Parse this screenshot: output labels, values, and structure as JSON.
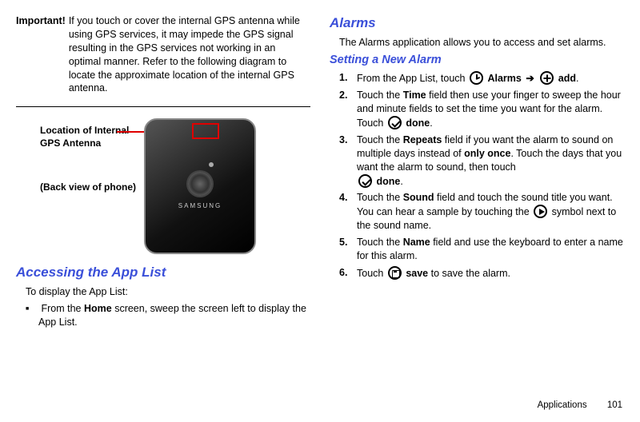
{
  "left": {
    "important_label": "Important!",
    "important_text": "If you touch or cover the internal GPS antenna while using GPS services, it may impede the GPS signal resulting in the GPS services not working in an optimal manner. Refer to the following diagram to locate the approximate location of the internal GPS antenna.",
    "diagram": {
      "label_top": "Location of Internal GPS Antenna",
      "label_bottom": "(Back view of phone)",
      "brand": "SAMSUNG"
    },
    "section_heading": "Accessing the App List",
    "intro": "To display the App List:",
    "bullet_pre": "From the ",
    "bullet_bold": "Home",
    "bullet_post": " screen, sweep the screen left to display the App List."
  },
  "right": {
    "heading_alarms": "Alarms",
    "alarms_intro": "The Alarms application allows you to access and set alarms.",
    "heading_set": "Setting a New Alarm",
    "step1": {
      "t1": "From the App List, touch ",
      "b1": "Alarms",
      "b2": "add",
      "end": "."
    },
    "step2": {
      "t1": "Touch the ",
      "b1": "Time",
      "t2": " field then use your finger to sweep the hour and minute fields to set the time you want for the alarm. Touch ",
      "b2": "done",
      "end": "."
    },
    "step3": {
      "t1": "Touch the ",
      "b1": "Repeats",
      "t2": " field if you want the alarm to sound on multiple days instead of ",
      "b2": "only once",
      "t3": ". Touch the days that you want the alarm to sound, then touch ",
      "b3": "done",
      "end": "."
    },
    "step4": {
      "t1": "Touch the ",
      "b1": "Sound",
      "t2": " field and touch the sound title you want. You can hear a sample by touching the ",
      "t3": " symbol next to the sound name."
    },
    "step5": {
      "t1": "Touch the ",
      "b1": "Name",
      "t2": " field and use the keyboard to enter a name for this alarm."
    },
    "step6": {
      "t1": "Touch ",
      "b1": "save",
      "t2": " to save the alarm."
    }
  },
  "footer": {
    "section": "Applications",
    "page": "101"
  }
}
